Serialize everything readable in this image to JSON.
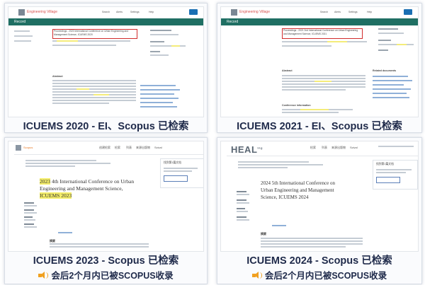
{
  "panels": [
    {
      "caption": "ICUEMS 2020 - EI、Scopus 已检索",
      "header": {
        "brand": "Engineering Village",
        "section": "Record",
        "menu": [
          "Search",
          "Alerts",
          "Settings",
          "Help"
        ]
      },
      "record_title": "Proceedings - 2020 International Conference on Urban Engineering and Management Science, ICUEMS 2020",
      "side_label": "Abstract"
    },
    {
      "caption": "ICUEMS 2021 - EI、Scopus 已检索",
      "header": {
        "brand": "Engineering Village",
        "section": "Record",
        "menu": [
          "Search",
          "Alerts",
          "Settings",
          "Help"
        ]
      },
      "record_title": "Proceedings - 2021 2nd International Conference on Urban Engineering and Management Science, ICUEMS 2021",
      "side_label": "Abstract",
      "related": "Related documents",
      "conference": "Conference information"
    },
    {
      "caption": "ICUEMS 2023 - Scopus 已检索",
      "note": "会后2个月内已被SCOPUS收录",
      "header": {
        "brand": "Scopus",
        "menu": [
          "创建检索",
          "检索",
          "列表",
          "来源出版物",
          "Scival"
        ]
      },
      "title_line1_prefix": "2023",
      "title_line1_rest": " 4th International Conference on Urban",
      "title_line2": "Engineering and Management Science,",
      "title_line3": "ICUEMS 2023",
      "side_heading": "摘要",
      "side_box": "找到第1篇文档"
    },
    {
      "caption": "ICUEMS 2024 - Scopus 已检索",
      "note": "会后2个月内已被SCOPUS收录",
      "header": {
        "brand": "HEAL",
        "menu": [
          "检索",
          "列表",
          "来源出版物",
          "Scival"
        ]
      },
      "title_line1": "2024 5th International Conference on",
      "title_line2": "Urban Engineering and Management",
      "title_line3": "Science, ICUEMS 2024",
      "side_heading": "摘要",
      "side_box": "找到第1篇文档"
    }
  ],
  "colors": {
    "ev_green": "#1f6f63",
    "highlight": "#f4ec7a",
    "box_red": "#d12c2c",
    "caption": "#1f2a4a",
    "speaker": "#f0a020"
  },
  "icons": [
    "speaker-icon"
  ]
}
